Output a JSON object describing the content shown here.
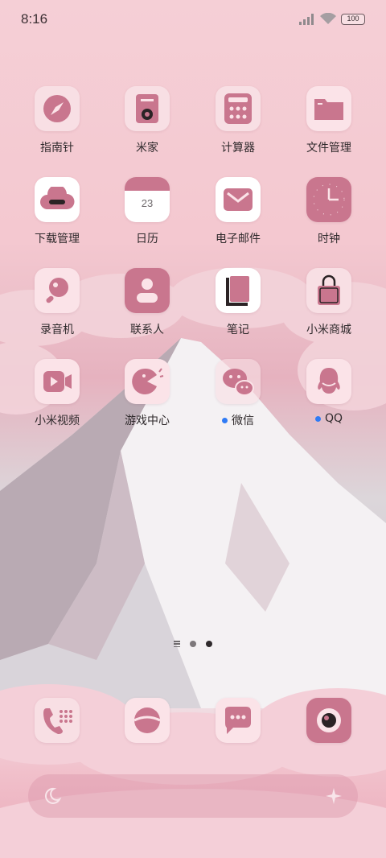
{
  "status_bar": {
    "time": "8:16",
    "battery": "100"
  },
  "apps": [
    {
      "label": "指南针",
      "icon": "compass-icon"
    },
    {
      "label": "米家",
      "icon": "mijia-icon"
    },
    {
      "label": "计算器",
      "icon": "calculator-icon"
    },
    {
      "label": "文件管理",
      "icon": "folder-icon"
    },
    {
      "label": "下载管理",
      "icon": "download-cloud-icon"
    },
    {
      "label": "日历",
      "icon": "calendar-icon",
      "badge_text": "23"
    },
    {
      "label": "电子邮件",
      "icon": "mail-icon"
    },
    {
      "label": "时钟",
      "icon": "clock-icon"
    },
    {
      "label": "录音机",
      "icon": "recorder-icon"
    },
    {
      "label": "联系人",
      "icon": "contacts-icon"
    },
    {
      "label": "笔记",
      "icon": "notes-icon"
    },
    {
      "label": "小米商城",
      "icon": "shopping-bag-icon"
    },
    {
      "label": "小米视频",
      "icon": "video-icon"
    },
    {
      "label": "游戏中心",
      "icon": "game-center-icon"
    },
    {
      "label": "微信",
      "icon": "wechat-icon",
      "new_dot": true
    },
    {
      "label": "QQ",
      "icon": "qq-icon",
      "new_dot": true
    }
  ],
  "dock": [
    {
      "icon": "phone-icon"
    },
    {
      "icon": "browser-icon"
    },
    {
      "icon": "messages-icon"
    },
    {
      "icon": "camera-icon"
    }
  ],
  "search_bar": {
    "left_icon": "moon-icon",
    "right_icon": "sparkle-icon"
  },
  "colors": {
    "accent": "#c9768e",
    "tile_light": "#f8dfe4",
    "notification_dot": "#2f7bf5"
  }
}
